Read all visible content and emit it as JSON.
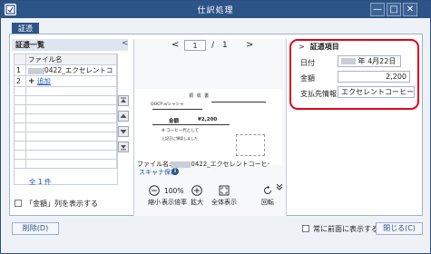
{
  "window": {
    "title": "仕訳処理",
    "minimize": "—",
    "maximize": "□",
    "close": "✕"
  },
  "tab": {
    "label": "証憑"
  },
  "list_panel": {
    "title": "証憑一覧",
    "collapse_glyph": "<",
    "column_header": "ファイル名",
    "rows": [
      {
        "num": "1",
        "name": "0422_エクセレントコ"
      },
      {
        "num": "2",
        "name": "追加"
      }
    ],
    "count_text": "全 1 件",
    "show_amount_label": "「金額」列を表示する"
  },
  "viewer": {
    "prev": "<",
    "page_current": "1",
    "page_separator": "/",
    "page_total": "1",
    "next": ">",
    "file_label": "ファイル名:",
    "file_name": "0422_エクセレントコーヒ-",
    "scan_label": "スキャナ保存",
    "scan_info": "i",
    "zoom_percent": "100%",
    "tools": [
      {
        "label": "縮小"
      },
      {
        "label": "表示倍率"
      },
      {
        "label": "拡大"
      },
      {
        "label": "全体表示"
      },
      {
        "label": "回転"
      }
    ],
    "doc": {
      "heading": "領 収 書",
      "company": "OOCP e/シャシャ",
      "amount_label": "金額",
      "amount": "¥2,200",
      "desc": "※ コーヒー代として",
      "sub": "上記正に領収しました"
    }
  },
  "detail_panel": {
    "title": "証憑項目",
    "expand_glyph": ">",
    "fields": [
      {
        "label": "日付",
        "value": "年 4月22日"
      },
      {
        "label": "金額",
        "value": "2,200"
      },
      {
        "label": "支払先情報",
        "value": "エクセレントコーヒー"
      }
    ]
  },
  "footer": {
    "delete_label": "削除(D)",
    "always_front_label": "常に前面に表示する",
    "close_label": "閉じる(C)"
  },
  "colors": {
    "titlebar": "#2d5487",
    "highlight": "#e3001b"
  }
}
